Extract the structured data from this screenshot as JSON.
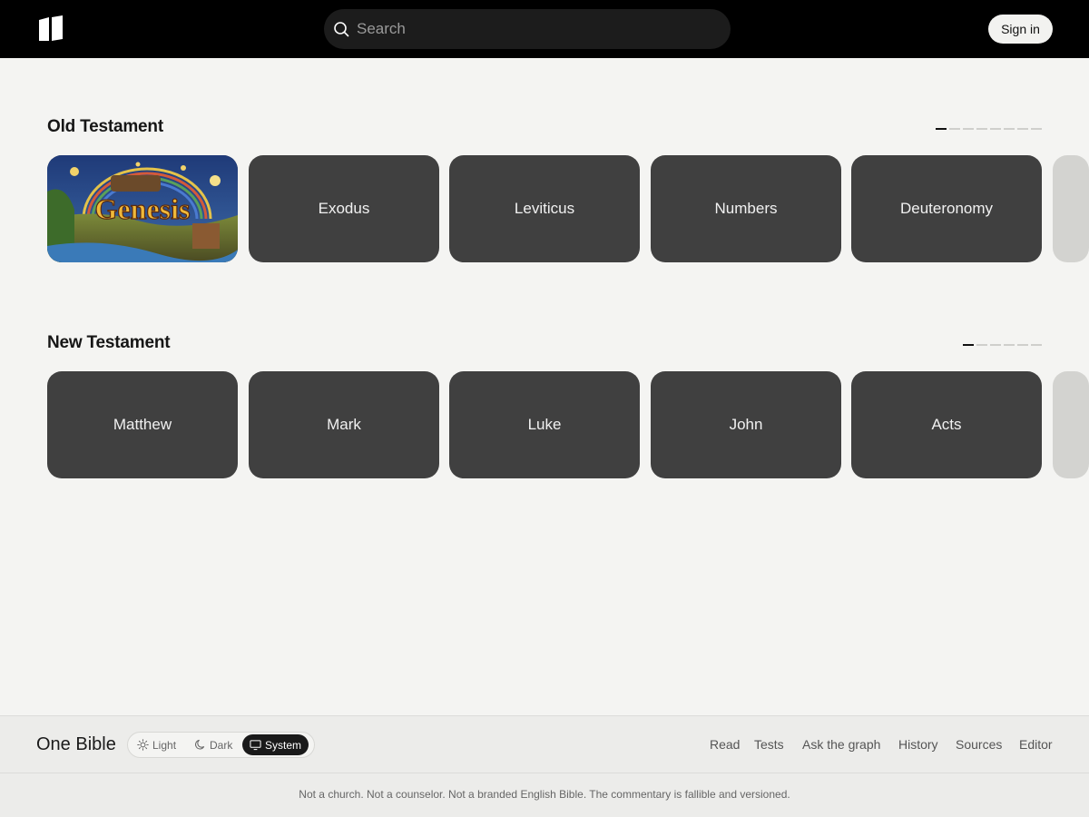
{
  "header": {
    "logo_icon": "open-book-icon",
    "search": {
      "placeholder": "Search",
      "icon": "search-icon"
    },
    "signin_label": "Sign in"
  },
  "old_testament": {
    "title": "Old Testament",
    "pager": {
      "pages": 8,
      "active": 1
    },
    "books": [
      {
        "label": "Genesis",
        "has_image": true
      },
      {
        "label": "Exodus"
      },
      {
        "label": "Leviticus"
      },
      {
        "label": "Numbers"
      },
      {
        "label": "Deuteronomy"
      }
    ]
  },
  "new_testament": {
    "title": "New Testament",
    "pager": {
      "pages": 6,
      "active": 1
    },
    "books": [
      {
        "label": "Matthew"
      },
      {
        "label": "Mark"
      },
      {
        "label": "Luke"
      },
      {
        "label": "John"
      },
      {
        "label": "Acts"
      }
    ]
  },
  "footer": {
    "brand": "One Bible",
    "theme": {
      "options": [
        {
          "label": "Light",
          "icon": "sun-icon"
        },
        {
          "label": "Dark",
          "icon": "moon-icon"
        },
        {
          "label": "System",
          "icon": "monitor-icon"
        }
      ],
      "selected": "System"
    },
    "links": [
      "Read",
      "Tests",
      "Ask the graph",
      "History",
      "Sources",
      "Editor"
    ],
    "disclaimer": "Not a church. Not a counselor. Not a branded English Bible. The commentary is fallible and versioned."
  },
  "colors": {
    "topbar": "#000000",
    "background": "#f4f4f2",
    "card": "#404040",
    "accent_active": "#1a1a1a"
  }
}
